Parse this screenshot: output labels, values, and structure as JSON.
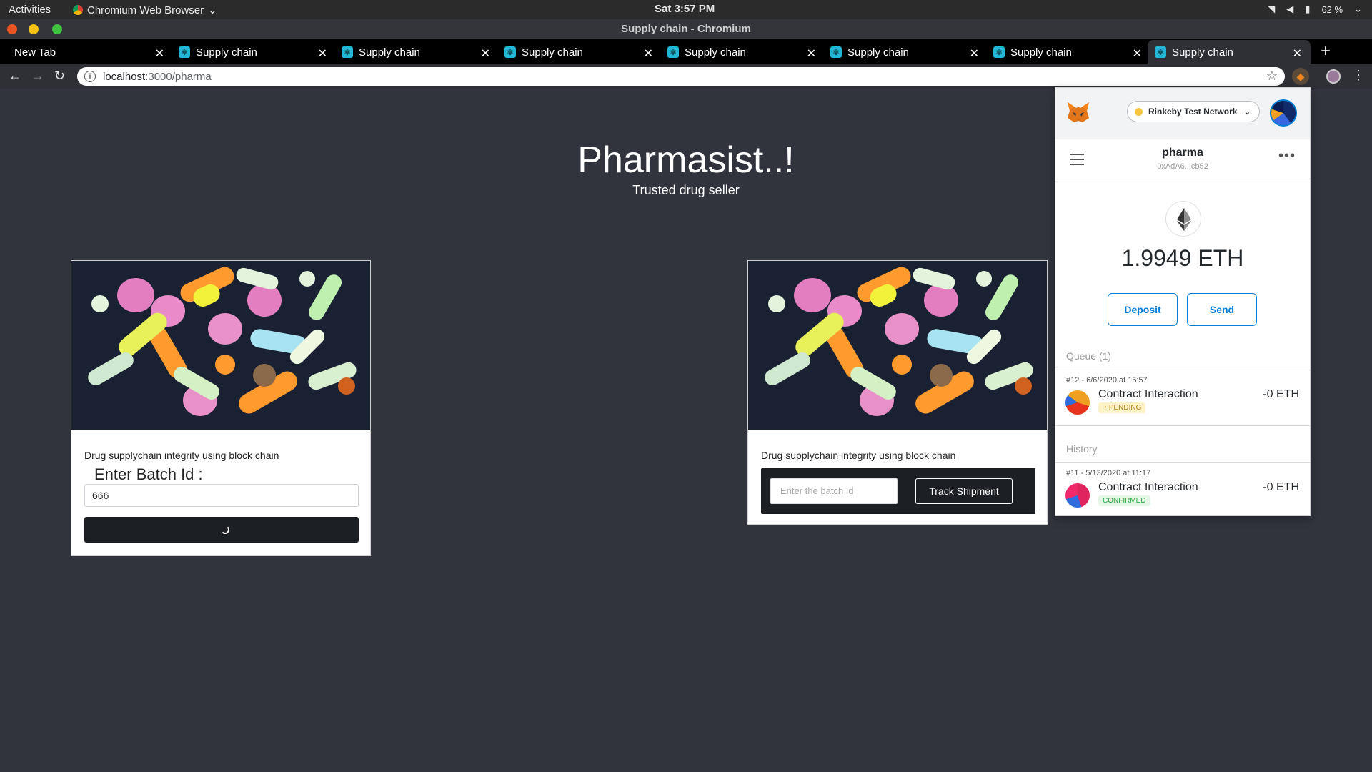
{
  "topbar": {
    "activities": "Activities",
    "app_name": "Chromium Web Browser",
    "clock": "Sat  3:57 PM",
    "battery": "62 %"
  },
  "window": {
    "title": "Supply chain - Chromium"
  },
  "tabs": [
    {
      "label": "New Tab"
    },
    {
      "label": "Supply chain"
    },
    {
      "label": "Supply chain"
    },
    {
      "label": "Supply chain"
    },
    {
      "label": "Supply chain"
    },
    {
      "label": "Supply chain"
    },
    {
      "label": "Supply chain"
    },
    {
      "label": "Supply chain"
    }
  ],
  "address": {
    "host": "localhost",
    "path": ":3000/pharma"
  },
  "page": {
    "title": "Pharmasist..!",
    "subtitle": "Trusted drug seller",
    "left_card": {
      "description": "Drug supplychain integrity using block chain",
      "batch_label": "Enter Batch Id :",
      "batch_value": "666"
    },
    "right_card": {
      "description": "Drug supplychain integrity using block chain",
      "input_placeholder": "Enter the batch Id",
      "button_label": "Track Shipment"
    }
  },
  "metamask": {
    "network": "Rinkeby Test Network",
    "account_name": "pharma",
    "account_address": "0xAdA6...cb52",
    "balance": "1.9949 ETH",
    "deposit_label": "Deposit",
    "send_label": "Send",
    "queue_label": "Queue (1)",
    "history_label": "History",
    "queue": [
      {
        "date": "#12 - 6/6/2020 at 15:57",
        "title": "Contract Interaction",
        "amount": "-0 ETH",
        "status": "PENDING"
      }
    ],
    "history": [
      {
        "date": "#11 - 5/13/2020 at 11:17",
        "title": "Contract Interaction",
        "amount": "-0 ETH",
        "status": "CONFIRMED"
      }
    ]
  },
  "colors": {
    "page_bg": "#31343d",
    "metamask_blue": "#037dd6",
    "pending_bg": "#fef3c7",
    "confirmed_bg": "#e6f6e6"
  }
}
